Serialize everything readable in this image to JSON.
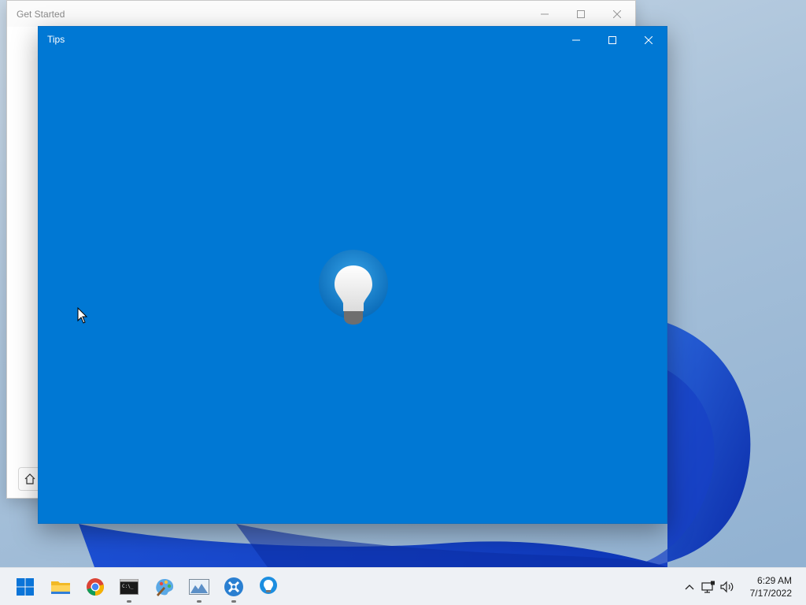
{
  "windows": {
    "get_started": {
      "title": "Get Started",
      "controls": {
        "minimize": "minimize",
        "maximize": "maximize",
        "close": "close"
      }
    },
    "tips": {
      "title": "Tips",
      "background": "#0078d4",
      "splash_icon": "lightbulb-icon"
    }
  },
  "taskbar": {
    "apps": [
      {
        "name": "start",
        "icon": "windows-logo-icon",
        "running": false
      },
      {
        "name": "file-explorer",
        "icon": "folder-icon",
        "running": false
      },
      {
        "name": "chrome",
        "icon": "chrome-icon",
        "running": false
      },
      {
        "name": "terminal",
        "icon": "terminal-icon",
        "running": true
      },
      {
        "name": "paint",
        "icon": "paint-palette-icon",
        "running": false
      },
      {
        "name": "image-viewer",
        "icon": "image-icon",
        "running": true
      },
      {
        "name": "app",
        "icon": "x-app-icon",
        "running": true
      },
      {
        "name": "tips",
        "icon": "lightbulb-icon",
        "running": false
      }
    ],
    "tray": {
      "icons": [
        "chevron-up-icon",
        "network-icon",
        "volume-icon"
      ],
      "time": "6:29 AM",
      "date": "7/17/2022"
    }
  },
  "colors": {
    "accent": "#0078d4",
    "taskbar": "#eef1f5"
  }
}
